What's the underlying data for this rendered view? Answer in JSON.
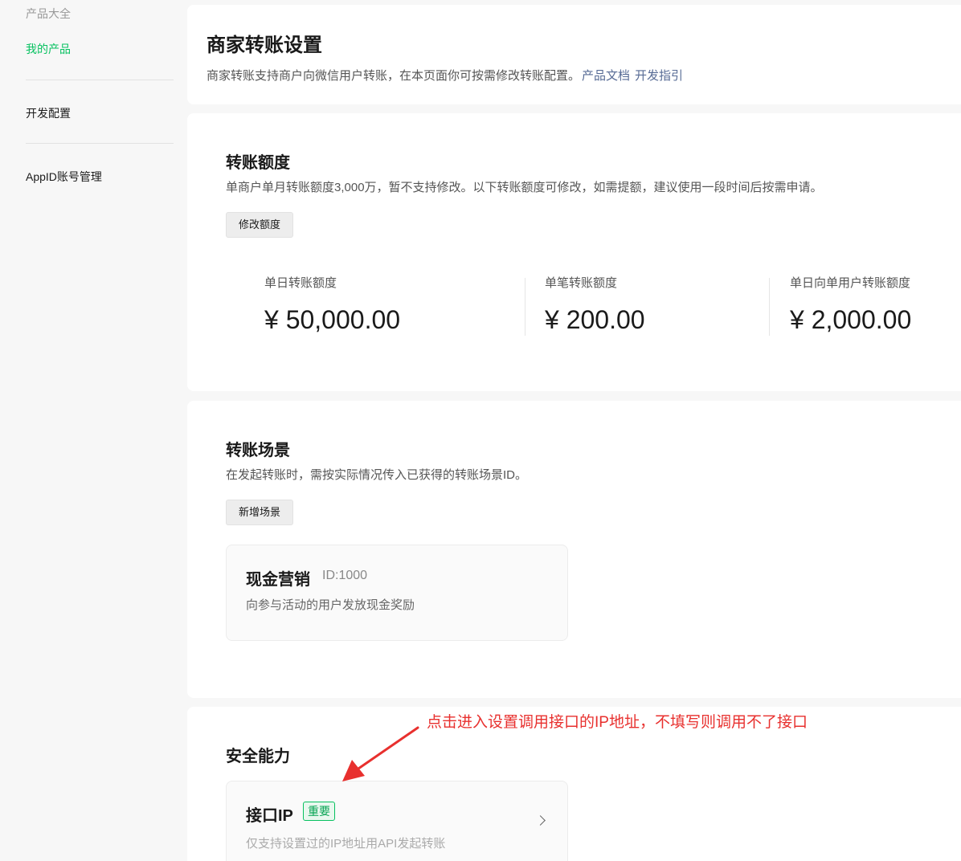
{
  "sidebar": {
    "items": [
      {
        "label": "产品大全"
      },
      {
        "label": "我的产品"
      },
      {
        "label": "开发配置"
      },
      {
        "label": "AppID账号管理"
      }
    ]
  },
  "header": {
    "title": "商家转账设置",
    "desc": "商家转账支持商户向微信用户转账，在本页面你可按需修改转账配置。",
    "link_doc": "产品文档",
    "link_guide": "开发指引"
  },
  "quota": {
    "title": "转账额度",
    "desc": "单商户单月转账额度3,000万，暂不支持修改。以下转账额度可修改，如需提额，建议使用一段时间后按需申请。",
    "button": "修改额度",
    "items": [
      {
        "label": "单日转账额度",
        "value": "¥ 50,000.00"
      },
      {
        "label": "单笔转账额度",
        "value": "¥ 200.00"
      },
      {
        "label": "单日向单用户转账额度",
        "value": "¥ 2,000.00"
      }
    ]
  },
  "scenes": {
    "title": "转账场景",
    "desc": "在发起转账时，需按实际情况传入已获得的转账场景ID。",
    "button": "新增场景",
    "card": {
      "title": "现金营销",
      "id": "ID:1000",
      "desc": "向参与活动的用户发放现金奖励"
    }
  },
  "security": {
    "title": "安全能力",
    "ip_card": {
      "title": "接口IP",
      "badge": "重要",
      "desc": "仅支持设置过的IP地址用API发起转账"
    }
  },
  "annotation": {
    "text": "点击进入设置调用接口的IP地址，不填写则调用不了接口",
    "color": "#e8302e"
  },
  "colors": {
    "accent": "#07c160",
    "link": "#576b95"
  }
}
